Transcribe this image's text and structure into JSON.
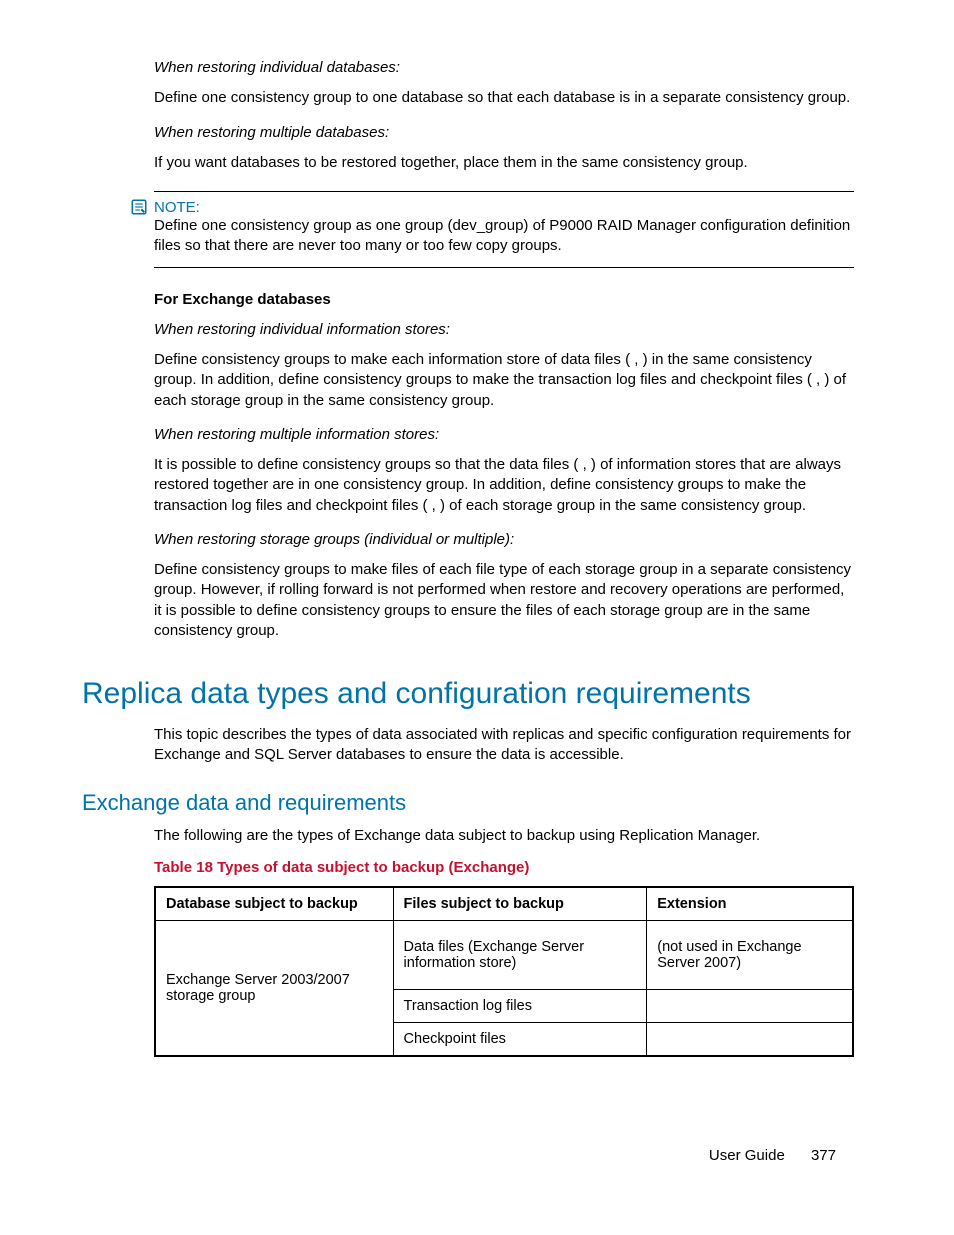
{
  "section1": {
    "h_restore_individual_db": "When restoring individual databases:",
    "p_restore_individual_db": "Define one consistency group to one database so that each database is in a separate consistency group.",
    "h_restore_multiple_db": "When restoring multiple databases:",
    "p_restore_multiple_db": "If you want databases to be restored together, place them in the same consistency group."
  },
  "note": {
    "label": "NOTE:",
    "text": "Define one consistency group as one group (dev_group) of P9000 RAID Manager configuration definition files so that there are never too many or too few copy groups."
  },
  "exchange_db": {
    "heading": "For Exchange databases",
    "h_individual_stores": "When restoring individual information stores:",
    "p_individual_stores": "Define consistency groups to make each information store of data files (             ,             ) in the same consistency group. In addition, define consistency groups to make the transaction log files and checkpoint files (             ,             ) of each storage group in the same consistency group.",
    "h_multiple_stores": "When restoring multiple information stores:",
    "p_multiple_stores": "It is possible to define consistency groups so that the data files (             ,             ) of information stores that are always restored together are in one consistency group. In addition, define consistency groups to make the transaction log files and checkpoint files (             ,             ) of each storage group in the same consistency group.",
    "h_storage_groups": "When restoring storage groups (individual or multiple):",
    "p_storage_groups": "Define consistency groups to make files of each file type of each storage group in a separate consistency group. However, if rolling forward is not performed when restore and recovery operations are performed, it is possible to define consistency groups to ensure the files of each storage group are in the same consistency group."
  },
  "main_heading": "Replica data types and configuration requirements",
  "main_intro": "This topic describes the types of data associated with replicas and specific configuration requirements for Exchange and SQL Server databases to ensure the data is accessible.",
  "sub_heading": "Exchange data and requirements",
  "sub_intro": "The following are the types of Exchange data subject to backup using Replication Manager.",
  "table_caption": "Table 18 Types of data subject to backup (Exchange)",
  "table": {
    "headers": {
      "col1": "Database subject to backup",
      "col2": "Files subject to backup",
      "col3": "Extension"
    },
    "row_db": "Exchange Server 2003/2007 storage group",
    "row1_files": "Data files (Exchange Server information store)",
    "row1_ext": " (not used in Exchange Server 2007)",
    "row2_files": "Transaction log files",
    "row3_files": "Checkpoint files"
  },
  "footer": {
    "label": "User Guide",
    "page": "377"
  }
}
